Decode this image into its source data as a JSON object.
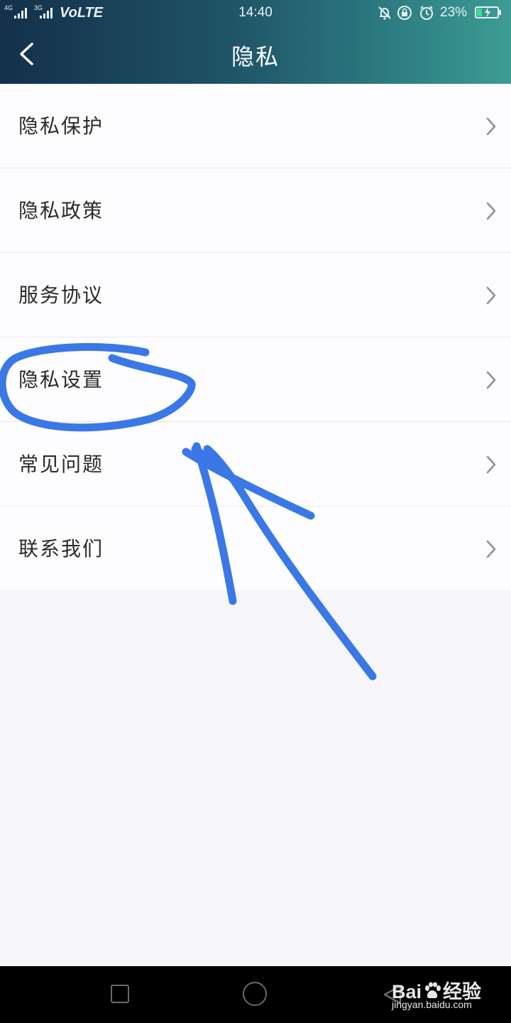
{
  "status_bar": {
    "net_1": "4G",
    "net_2": "3G",
    "volte": "VoLTE",
    "time": "14:40",
    "battery": "23%",
    "icons": [
      "bell-off-icon",
      "rotation-lock-icon",
      "alarm-icon",
      "battery-icon"
    ]
  },
  "header": {
    "title": "隐私",
    "back_icon": "chevron-left-icon"
  },
  "menu": {
    "items": [
      {
        "label": "隐私保护"
      },
      {
        "label": "隐私政策"
      },
      {
        "label": "服务协议"
      },
      {
        "label": "隐私设置"
      },
      {
        "label": "常见问题"
      },
      {
        "label": "联系我们"
      }
    ]
  },
  "annotation": {
    "color": "#3a78e6",
    "circled_item": "隐私设置",
    "shape": "hand-drawn circle with arrow"
  },
  "watermark": {
    "brand_prefix": "Bai",
    "brand_suffix": "经验",
    "url": "jingyan.baidu.com"
  },
  "colors": {
    "header_start": "#14304a",
    "header_end": "#3c9c94",
    "battery_fill": "#38e08a"
  }
}
